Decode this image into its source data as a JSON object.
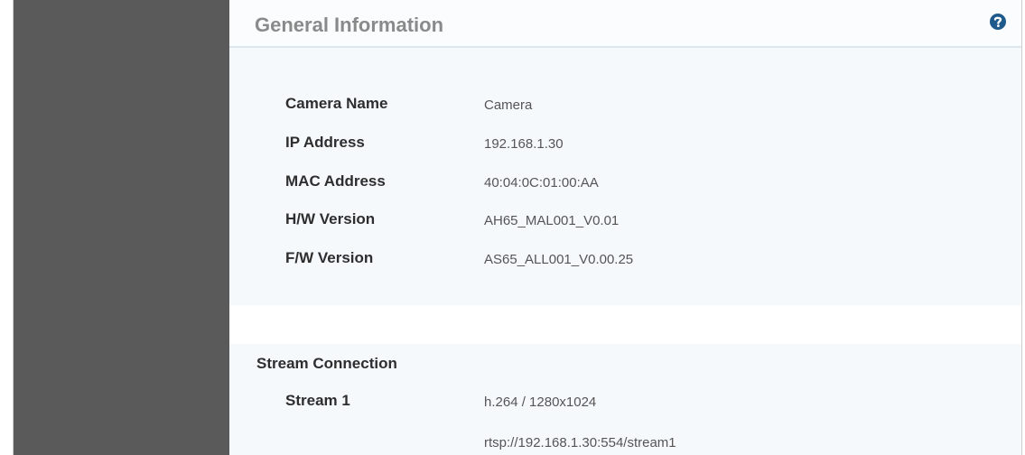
{
  "header": {
    "title": "General Information"
  },
  "help": {
    "icon": "help-icon",
    "color": "#1e5a8c"
  },
  "general_info": {
    "rows": [
      {
        "label": "Camera Name",
        "value": "Camera"
      },
      {
        "label": "IP Address",
        "value": "192.168.1.30"
      },
      {
        "label": "MAC Address",
        "value": "40:04:0C:01:00:AA"
      },
      {
        "label": "H/W Version",
        "value": "AH65_MAL001_V0.01"
      },
      {
        "label": "F/W Version",
        "value": "AS65_ALL001_V0.00.25"
      }
    ]
  },
  "stream_connection": {
    "title": "Stream Connection",
    "streams": [
      {
        "label": "Stream 1",
        "codec": "h.264 / 1280x1024",
        "url": "rtsp://192.168.1.30:554/stream1"
      }
    ]
  },
  "colors": {
    "sidebar": "#5a5a5a",
    "panel": "#f5f9fc",
    "header_border": "#dce7ee"
  }
}
